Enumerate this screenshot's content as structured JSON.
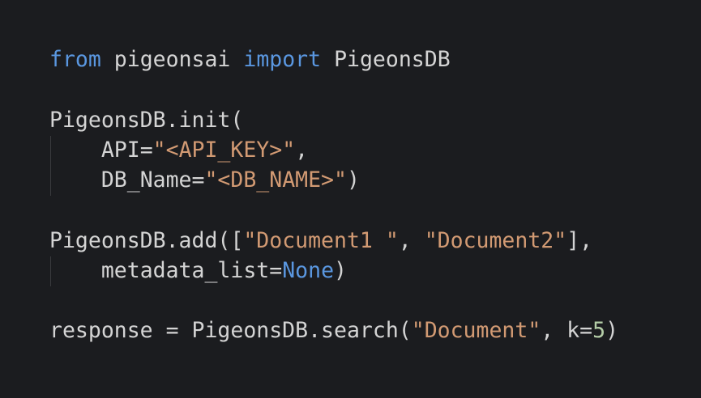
{
  "code": {
    "import": {
      "from": "from",
      "module": "pigeonsai",
      "import": "import",
      "name": "PigeonsDB"
    },
    "init": {
      "call": "PigeonsDB.init(",
      "api_key": "API=",
      "api_val": "\"<API_KEY>\"",
      "api_comma": ",",
      "db_key": "DB_Name=",
      "db_val": "\"<DB_NAME>\"",
      "db_close": ")"
    },
    "add": {
      "call": "PigeonsDB.add([",
      "doc1": "\"Document1 \"",
      "sep": ", ",
      "doc2": "\"Document2\"",
      "close": "],",
      "meta_key": "metadata_list=",
      "meta_val": "None",
      "meta_close": ")"
    },
    "search": {
      "lhs": "response = PigeonsDB.search(",
      "query": "\"Document\"",
      "sep": ", k=",
      "k": "5",
      "close": ")"
    }
  }
}
